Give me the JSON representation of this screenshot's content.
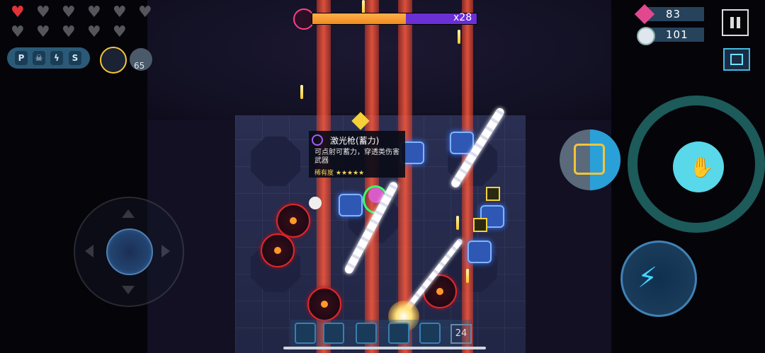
{
  "hud": {
    "hearts": {
      "filled": 1,
      "total": 11
    },
    "buff_badges": [
      "P",
      "S"
    ],
    "ally_count": "65",
    "boss": {
      "health_fraction": 0.57,
      "shield_fraction": 0.43,
      "multiplier": "x28"
    },
    "gems": "83",
    "coins": "101"
  },
  "weapon_tooltip": {
    "name": "激光枪(蓄力)",
    "description": "可点射可蓄力，穿透类伤害武器",
    "rarity_label": "稀有度",
    "stars": "★★★★★"
  },
  "hotbar": {
    "count": "24"
  },
  "colors": {
    "health": "#e03238",
    "boss": "#f08a20",
    "shield": "#6b2fd6",
    "gem": "#e2488f",
    "accent": "#58d8e8"
  },
  "icons": [
    "heart-icon",
    "skull-icon",
    "lightning-icon",
    "gem-icon",
    "coin-icon",
    "pause-icon",
    "map-icon",
    "hand-icon",
    "claw-icon",
    "skill-icon"
  ]
}
